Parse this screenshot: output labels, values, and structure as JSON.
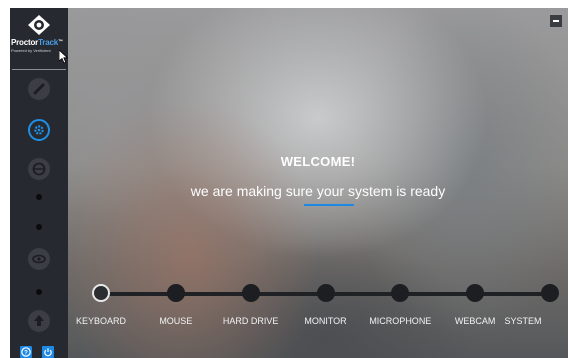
{
  "brand": {
    "name_part1": "Proctor",
    "name_part2": "Track",
    "trademark": "™",
    "tagline": "Powered by Verificient",
    "logo_icon": "eye-icon"
  },
  "sidebar": {
    "items": [
      {
        "icon": "pencil-icon",
        "state": "inactive"
      },
      {
        "icon": "gear-icon",
        "state": "active"
      },
      {
        "icon": "face-icon",
        "state": "inactive"
      },
      {
        "icon": "dot",
        "state": "inactive"
      },
      {
        "icon": "dot",
        "state": "inactive"
      },
      {
        "icon": "eye-icon",
        "state": "inactive"
      },
      {
        "icon": "dot",
        "state": "inactive"
      },
      {
        "icon": "upload-icon",
        "state": "inactive"
      }
    ],
    "bottom_buttons": [
      {
        "icon": "help-icon",
        "label": "?"
      },
      {
        "icon": "power-icon",
        "label": ""
      }
    ]
  },
  "main": {
    "title": "WELCOME!",
    "subtitle": "we are making sure your system is ready",
    "accent_color": "#1e88e5",
    "steps": [
      {
        "label": "KEYBOARD",
        "state": "current"
      },
      {
        "label": "MOUSE",
        "state": "pending"
      },
      {
        "label": "HARD DRIVE",
        "state": "pending"
      },
      {
        "label": "MONITOR",
        "state": "pending"
      },
      {
        "label": "MICROPHONE",
        "state": "pending"
      },
      {
        "label": "WEBCAM",
        "state": "pending"
      },
      {
        "label": "SYSTEM",
        "state": "pending"
      }
    ]
  }
}
